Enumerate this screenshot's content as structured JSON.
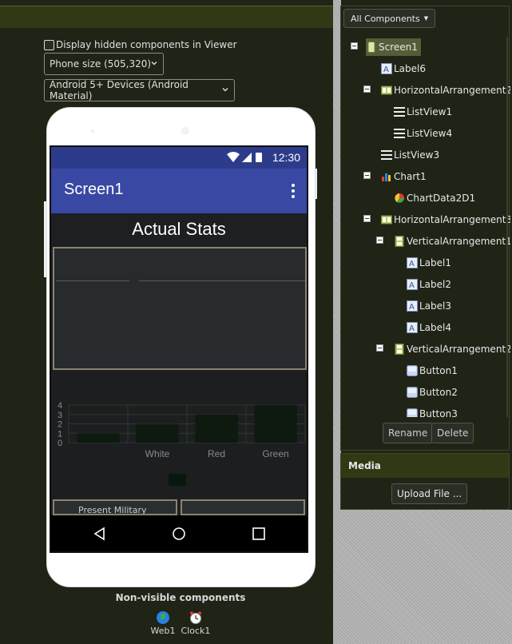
{
  "viewer": {
    "display_hidden_label": "Display hidden components in Viewer",
    "phone_size": "Phone size (505,320)",
    "device_type": "Android 5+ Devices (Android Material)"
  },
  "phone": {
    "status_time": "12:30",
    "app_title": "Screen1",
    "label6_text": "Actual Stats",
    "vertical_arrangement1_text": "Present Military"
  },
  "chart_data": {
    "type": "bar",
    "categories": [
      "",
      "White",
      "Red",
      "Green"
    ],
    "values": [
      1,
      2,
      3,
      4
    ],
    "ylim": [
      0,
      4
    ],
    "yticks": [
      0,
      1,
      2,
      3,
      4
    ],
    "colors": {
      "bar": "#0e1a10",
      "grid": "#2c3a2c",
      "text": "#8a8a8a",
      "legend": "#0a170d"
    }
  },
  "nonvisible": {
    "title": "Non-visible components",
    "items": [
      {
        "label": "Web1",
        "icon": "globe-icon"
      },
      {
        "label": "Clock1",
        "icon": "alarm-clock-icon"
      }
    ]
  },
  "components": {
    "filter": "All Components",
    "tree": [
      {
        "label": "Screen1",
        "icon": "screen-icon"
      },
      {
        "label": "Label6",
        "icon": "label-icon"
      },
      {
        "label": "HorizontalArrangement2",
        "icon": "horizontal-arrangement-icon"
      },
      {
        "label": "ListView1",
        "icon": "listview-icon"
      },
      {
        "label": "ListView4",
        "icon": "listview-icon"
      },
      {
        "label": "ListView3",
        "icon": "listview-icon"
      },
      {
        "label": "Chart1",
        "icon": "chart-icon"
      },
      {
        "label": "ChartData2D1",
        "icon": "chartdata-icon"
      },
      {
        "label": "HorizontalArrangement3",
        "icon": "horizontal-arrangement-icon"
      },
      {
        "label": "VerticalArrangement1",
        "icon": "vertical-arrangement-icon"
      },
      {
        "label": "Label1",
        "icon": "label-icon"
      },
      {
        "label": "Label2",
        "icon": "label-icon"
      },
      {
        "label": "Label3",
        "icon": "label-icon"
      },
      {
        "label": "Label4",
        "icon": "label-icon"
      },
      {
        "label": "VerticalArrangement2",
        "icon": "vertical-arrangement-icon"
      },
      {
        "label": "Button1",
        "icon": "button-icon"
      },
      {
        "label": "Button2",
        "icon": "button-icon"
      },
      {
        "label": "Button3",
        "icon": "button-icon"
      }
    ],
    "rename_label": "Rename",
    "delete_label": "Delete"
  },
  "media": {
    "title": "Media",
    "upload_label": "Upload File ..."
  },
  "colors": {
    "statusbar": "#2d3c8a",
    "titlebar": "#3848a3",
    "panel_header": "#2f3a15"
  }
}
